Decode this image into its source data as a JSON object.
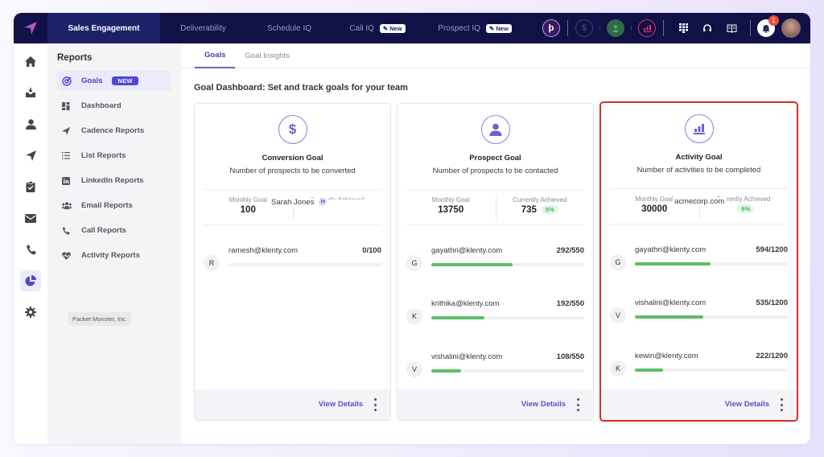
{
  "topnav": {
    "tabs": [
      {
        "label": "Sales Engagement",
        "active": true
      },
      {
        "label": "Deliverability"
      },
      {
        "label": "Schedule IQ"
      },
      {
        "label": "Call IQ",
        "badge": "✎ New"
      },
      {
        "label": "Prospect IQ",
        "badge": "✎ New"
      }
    ],
    "notification_count": "1",
    "icons": [
      "brand-p-icon",
      "dollar-icon",
      "contact-icon",
      "chart-icon",
      "dialpad-icon",
      "headset-icon",
      "book-icon",
      "bell-icon",
      "user-avatar"
    ]
  },
  "rail": {
    "items": [
      "home-icon",
      "inbox-icon",
      "person-icon",
      "send-icon",
      "clipboard-icon",
      "mail-icon",
      "phone-icon",
      "pie-chart-icon",
      "gear-icon"
    ],
    "active_index": 7
  },
  "subnav": {
    "title": "Reports",
    "items": [
      {
        "label": "Goals",
        "badge": "NEW",
        "icon": "target-icon",
        "active": true
      },
      {
        "label": "Dashboard",
        "icon": "dashboard-icon"
      },
      {
        "label": "Cadence Reports",
        "icon": "send-icon"
      },
      {
        "label": "List Reports",
        "icon": "list-icon"
      },
      {
        "label": "LinkedIn Reports",
        "icon": "linkedin-icon"
      },
      {
        "label": "Email Reports",
        "icon": "group-icon"
      },
      {
        "label": "Call Reports",
        "icon": "phone-icon"
      },
      {
        "label": "Activity Reports",
        "icon": "heart-pulse-icon"
      }
    ],
    "company": "Packet Monster, Inc."
  },
  "main": {
    "tabs": [
      {
        "label": "Goals",
        "active": true
      },
      {
        "label": "Goal Insights"
      }
    ],
    "title": "Goal Dashboard: Set and track goals for your team",
    "view_details": "View Details",
    "cards": [
      {
        "icon": "$",
        "title": "Conversion Goal",
        "subtitle": "Number of prospects to be converted",
        "monthly_goal_label": "Monthly Goal",
        "monthly_goal": "100",
        "achieved_label": "Currently Achieved",
        "achieved": "",
        "achieved_pct": "",
        "overlay": "Sarah Jones",
        "overlay_badge": "in",
        "rows": [
          {
            "initial": "R",
            "email": "ramesh@klenty.com",
            "count": "0/100",
            "progress": 0
          }
        ]
      },
      {
        "icon": "person",
        "title": "Prospect Goal",
        "subtitle": "Number of prospects to be contacted",
        "monthly_goal_label": "Monthly Goal",
        "monthly_goal": "13750",
        "achieved_label": "Currently Achieved",
        "achieved": "735",
        "achieved_pct": "5%",
        "rows": [
          {
            "initial": "G",
            "email": "gayathri@klenty.com",
            "count": "292/550",
            "progress": 0.531
          },
          {
            "initial": "K",
            "email": "krithika@klenty.com",
            "count": "192/550",
            "progress": 0.349
          },
          {
            "initial": "V",
            "email": "vishalini@klenty.com",
            "count": "108/550",
            "progress": 0.196
          }
        ]
      },
      {
        "icon": "bars",
        "title": "Activity Goal",
        "subtitle": "Number of activities to be completed",
        "monthly_goal_label": "Monthly Goal",
        "monthly_goal": "30000",
        "achieved_label": "Currently Achieved",
        "achieved": "",
        "achieved_pct": "6%",
        "overlay": "acmecorp.com",
        "highlighted": true,
        "rows": [
          {
            "initial": "G",
            "email": "gayathri@klenty.com",
            "count": "594/1200",
            "progress": 0.495
          },
          {
            "initial": "V",
            "email": "vishalini@klenty.com",
            "count": "535/1200",
            "progress": 0.446
          },
          {
            "initial": "K",
            "email": "kewin@klenty.com",
            "count": "222/1200",
            "progress": 0.185
          }
        ]
      }
    ]
  }
}
